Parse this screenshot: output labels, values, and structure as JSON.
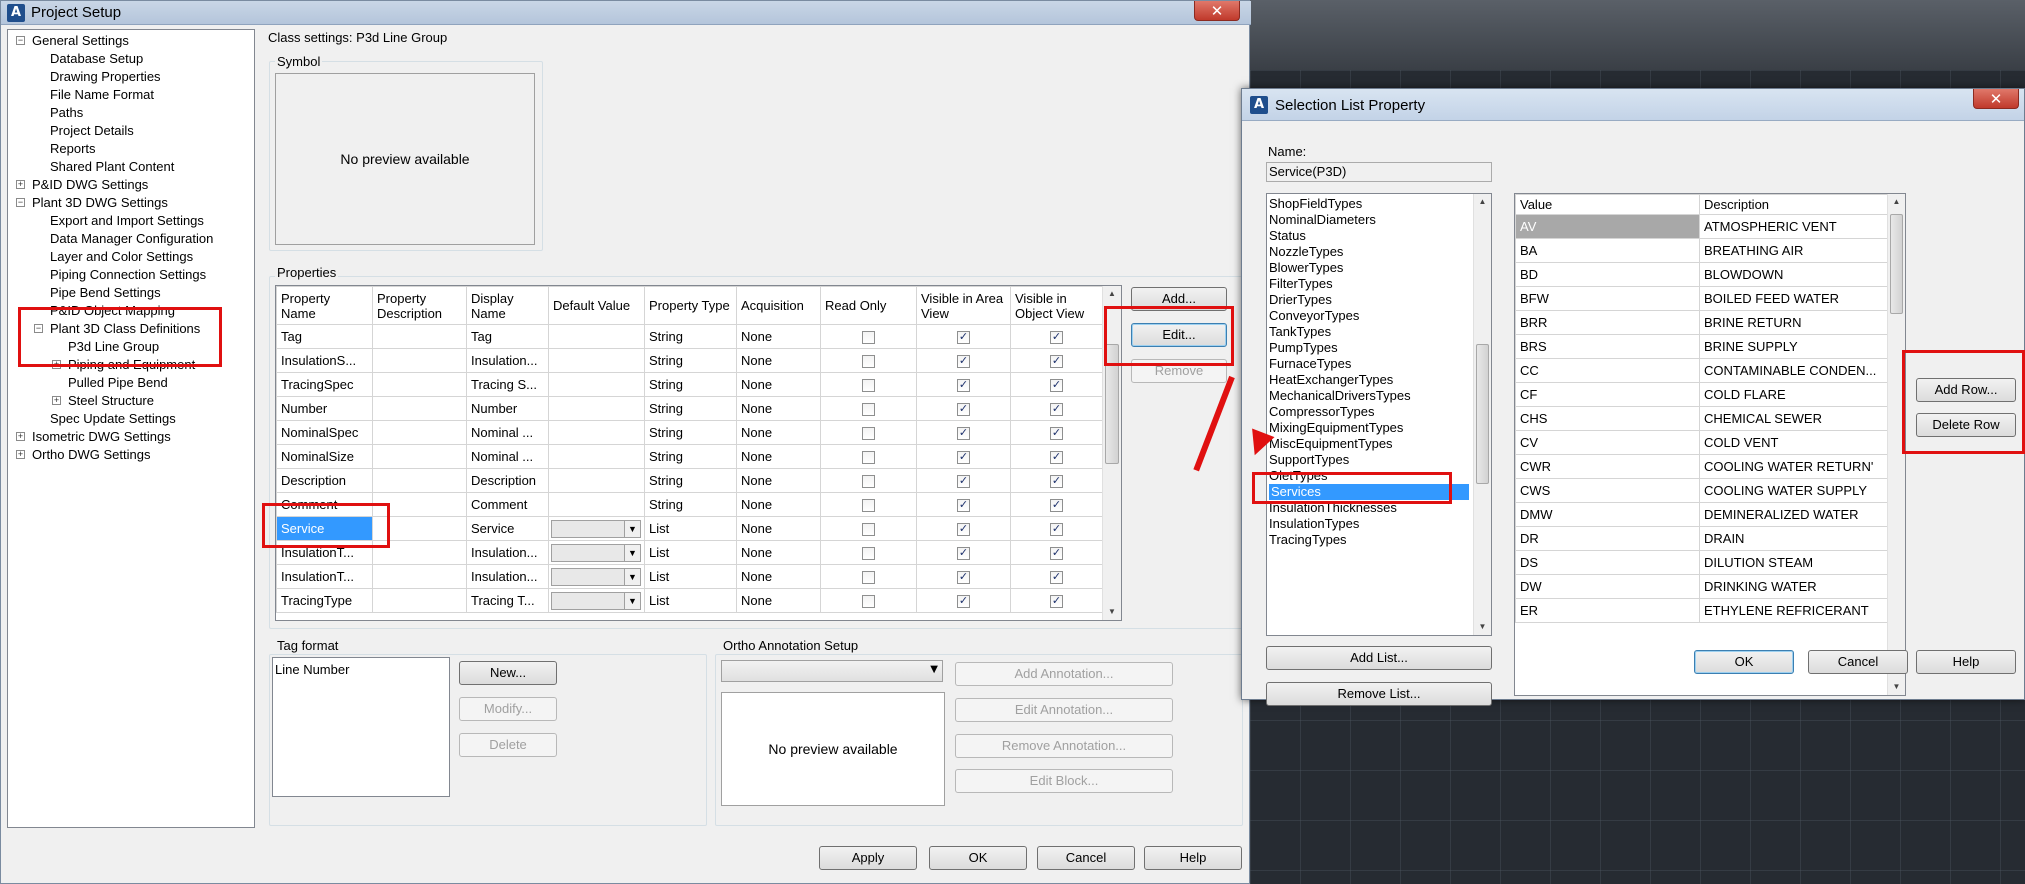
{
  "main_window": {
    "title": "Project Setup",
    "close_label": "✕"
  },
  "tree": [
    {
      "label": "General Settings",
      "depth": 0,
      "expander": "−"
    },
    {
      "label": "Database Setup",
      "depth": 1
    },
    {
      "label": "Drawing Properties",
      "depth": 1
    },
    {
      "label": "File Name Format",
      "depth": 1
    },
    {
      "label": "Paths",
      "depth": 1
    },
    {
      "label": "Project Details",
      "depth": 1
    },
    {
      "label": "Reports",
      "depth": 1
    },
    {
      "label": "Shared Plant Content",
      "depth": 1
    },
    {
      "label": "P&ID DWG Settings",
      "depth": 0,
      "expander": "+"
    },
    {
      "label": "Plant 3D DWG Settings",
      "depth": 0,
      "expander": "−"
    },
    {
      "label": "Export and Import Settings",
      "depth": 1
    },
    {
      "label": "Data Manager Configuration",
      "depth": 1
    },
    {
      "label": "Layer and Color Settings",
      "depth": 1
    },
    {
      "label": "Piping Connection Settings",
      "depth": 1
    },
    {
      "label": "Pipe Bend Settings",
      "depth": 1
    },
    {
      "label": "P&ID Object Mapping",
      "depth": 1
    },
    {
      "label": "Plant 3D Class Definitions",
      "depth": 1,
      "expander": "−"
    },
    {
      "label": "P3d Line Group",
      "depth": 2
    },
    {
      "label": "Piping and Equipment",
      "depth": 2,
      "expander": "+"
    },
    {
      "label": "Pulled Pipe Bend",
      "depth": 2
    },
    {
      "label": "Steel Structure",
      "depth": 2,
      "expander": "+"
    },
    {
      "label": "Spec Update Settings",
      "depth": 1
    },
    {
      "label": "Isometric DWG Settings",
      "depth": 0,
      "expander": "+"
    },
    {
      "label": "Ortho DWG Settings",
      "depth": 0,
      "expander": "+"
    }
  ],
  "class_settings": {
    "heading": "Class settings: P3d Line Group",
    "symbol_label": "Symbol",
    "no_preview": "No preview available",
    "properties_label": "Properties",
    "columns": [
      "Property Name",
      "Property Description",
      "Display Name",
      "Default Value",
      "Property Type",
      "Acquisition",
      "Read Only",
      "Visible in Area View",
      "Visible in Object View"
    ],
    "rows": [
      {
        "name": "Tag",
        "desc": "",
        "display": "Tag",
        "default": "",
        "type": "String",
        "acq": "None",
        "ro": false,
        "area": true,
        "obj": true
      },
      {
        "name": "InsulationS...",
        "desc": "",
        "display": "Insulation...",
        "default": "",
        "type": "String",
        "acq": "None",
        "ro": false,
        "area": true,
        "obj": true
      },
      {
        "name": "TracingSpec",
        "desc": "",
        "display": "Tracing S...",
        "default": "",
        "type": "String",
        "acq": "None",
        "ro": false,
        "area": true,
        "obj": true
      },
      {
        "name": "Number",
        "desc": "",
        "display": "Number",
        "default": "",
        "type": "String",
        "acq": "None",
        "ro": false,
        "area": true,
        "obj": true
      },
      {
        "name": "NominalSpec",
        "desc": "",
        "display": "Nominal ...",
        "default": "",
        "type": "String",
        "acq": "None",
        "ro": false,
        "area": true,
        "obj": true
      },
      {
        "name": "NominalSize",
        "desc": "",
        "display": "Nominal ...",
        "default": "",
        "type": "String",
        "acq": "None",
        "ro": false,
        "area": true,
        "obj": true
      },
      {
        "name": "Description",
        "desc": "",
        "display": "Description",
        "default": "",
        "type": "String",
        "acq": "None",
        "ro": false,
        "area": true,
        "obj": true
      },
      {
        "name": "Comment",
        "desc": "",
        "display": "Comment",
        "default": "",
        "type": "String",
        "acq": "None",
        "ro": false,
        "area": true,
        "obj": true
      },
      {
        "name": "Service",
        "desc": "",
        "display": "Service",
        "default": "dropdown",
        "type": "List",
        "acq": "None",
        "ro": false,
        "area": true,
        "obj": true
      },
      {
        "name": "InsulationT...",
        "desc": "",
        "display": "Insulation...",
        "default": "dropdown",
        "type": "List",
        "acq": "None",
        "ro": false,
        "area": true,
        "obj": true
      },
      {
        "name": "InsulationT...",
        "desc": "",
        "display": "Insulation...",
        "default": "dropdown",
        "type": "List",
        "acq": "None",
        "ro": false,
        "area": true,
        "obj": true
      },
      {
        "name": "TracingType",
        "desc": "",
        "display": "Tracing T...",
        "default": "dropdown",
        "type": "List",
        "acq": "None",
        "ro": false,
        "area": true,
        "obj": true
      }
    ],
    "add_button": "Add...",
    "edit_button": "Edit...",
    "remove_button": "Remove",
    "tag_format_label": "Tag format",
    "tag_format_value": "Line Number",
    "new_button": "New...",
    "modify_button": "Modify...",
    "delete_button": "Delete",
    "ortho_label": "Ortho Annotation Setup",
    "add_annotation": "Add Annotation...",
    "edit_annotation": "Edit Annotation...",
    "remove_annotation": "Remove Annotation...",
    "edit_block": "Edit Block...",
    "apply_button": "Apply",
    "ok_button": "OK",
    "cancel_button": "Cancel",
    "help_button": "Help"
  },
  "selection_dialog": {
    "title": "Selection List Property",
    "name_label": "Name:",
    "name_value": "Service(P3D)",
    "lists": [
      "ShopFieldTypes",
      "NominalDiameters",
      "Status",
      "NozzleTypes",
      "BlowerTypes",
      "FilterTypes",
      "DrierTypes",
      "ConveyorTypes",
      "TankTypes",
      "PumpTypes",
      "FurnaceTypes",
      "HeatExchangerTypes",
      "MechanicalDriversTypes",
      "CompressorTypes",
      "MixingEquipmentTypes",
      "MiscEquipmentTypes",
      "SupportTypes",
      "OletTypes",
      "Services",
      "InsulationThicknesses",
      "InsulationTypes",
      "TracingTypes"
    ],
    "selected_list": "Services",
    "add_list": "Add List...",
    "remove_list": "Remove List...",
    "value_header": "Value",
    "desc_header": "Description",
    "values": [
      [
        "AV",
        "ATMOSPHERIC VENT"
      ],
      [
        "BA",
        "BREATHING AIR"
      ],
      [
        "BD",
        "BLOWDOWN"
      ],
      [
        "BFW",
        "BOILED FEED WATER"
      ],
      [
        "BRR",
        "BRINE RETURN"
      ],
      [
        "BRS",
        "BRINE SUPPLY"
      ],
      [
        "CC",
        "CONTAMINABLE CONDEN..."
      ],
      [
        "CF",
        "COLD FLARE"
      ],
      [
        "CHS",
        "CHEMICAL SEWER"
      ],
      [
        "CV",
        "COLD VENT"
      ],
      [
        "CWR",
        "COOLING WATER RETURN'"
      ],
      [
        "CWS",
        "COOLING WATER SUPPLY"
      ],
      [
        "DMW",
        "DEMINERALIZED WATER"
      ],
      [
        "DR",
        "DRAIN"
      ],
      [
        "DS",
        "DILUTION STEAM"
      ],
      [
        "DW",
        "DRINKING WATER"
      ],
      [
        "ER",
        "ETHYLENE REFRICERANT"
      ]
    ],
    "add_row": "Add Row...",
    "delete_row": "Delete Row",
    "ok": "OK",
    "cancel": "Cancel",
    "help": "Help"
  },
  "colors": {
    "highlight": "#e01010",
    "selection": "#3399ff"
  }
}
